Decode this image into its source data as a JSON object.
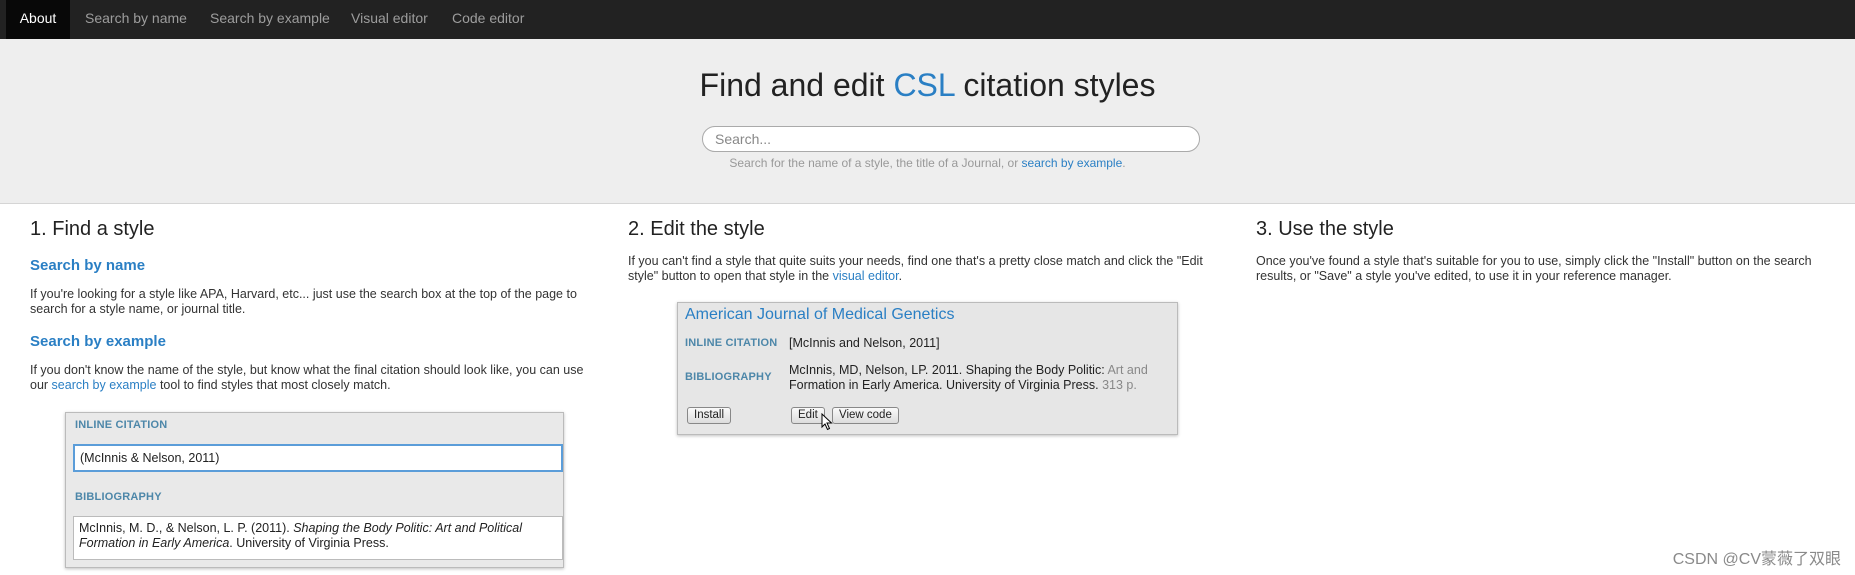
{
  "nav": {
    "items": [
      {
        "label": "About",
        "active": true
      },
      {
        "label": "Search by name",
        "active": false
      },
      {
        "label": "Search by example",
        "active": false
      },
      {
        "label": "Visual editor",
        "active": false
      },
      {
        "label": "Code editor",
        "active": false
      }
    ]
  },
  "hero": {
    "title_before": "Find and edit ",
    "title_accent": "CSL",
    "title_after": " citation styles",
    "search_placeholder": "Search...",
    "hint_before": "Search for the name of a style, the title of a Journal, or ",
    "hint_link": "search by example",
    "hint_after": "."
  },
  "find": {
    "heading": "1. Find a style",
    "by_name_heading": "Search by name",
    "by_name_text": "If you're looking for a style like APA, Harvard, etc... just use the search box at the top of the page to search for a style name, or journal title.",
    "by_example_heading": "Search by example",
    "by_example_text_before": "If you don't know the name of the style, but know what the final citation should look like, you can use our ",
    "by_example_link": "search by example",
    "by_example_text_after": " tool to find styles that most closely match.",
    "panel": {
      "inline_label": "INLINE CITATION",
      "inline_value": "(McInnis & Nelson, 2011)",
      "bib_label": "BIBLIOGRAPHY",
      "bib_before": "McInnis, M. D., & Nelson, L. P. (2011). ",
      "bib_italic": "Shaping the Body Politic: Art and Political Formation in Early America",
      "bib_after": ". University of Virginia Press."
    }
  },
  "edit": {
    "heading": "2. Edit the style",
    "text_before": "If you can't find a style that quite suits your needs, find one that's a pretty close match and click the \"Edit style\" button to open that style in the ",
    "text_link": "visual editor",
    "text_after": ".",
    "card": {
      "title": "American Journal of Medical Genetics",
      "inline_label": "INLINE CITATION",
      "inline_value": "[McInnis and Nelson, 2011]",
      "bib_label": "BIBLIOGRAPHY",
      "bib_line1": "McInnis, MD, Nelson, LP. 2011. Shaping the Body Politic:",
      "bib_line1_fade": " Art and",
      "bib_line2": "Formation in Early America. University of Virginia Press.",
      "bib_line2_fade": " 313 p.",
      "install_label": "Install",
      "edit_label": "Edit",
      "view_code_label": "View code"
    }
  },
  "use": {
    "heading": "3. Use the style",
    "text": "Once you've found a style that's suitable for you to use, simply click the \"Install\" button on the search results, or \"Save\" a style you've edited, to use it in your reference manager."
  },
  "watermark": "CSDN @CV蒙薇了双眼",
  "colors": {
    "navbar": "#222222",
    "accent": "#2a7fc4",
    "hero_bg": "#eeeeee",
    "label": "#4d87a9"
  },
  "icons": {
    "cursor": "mouse-pointer-icon"
  }
}
